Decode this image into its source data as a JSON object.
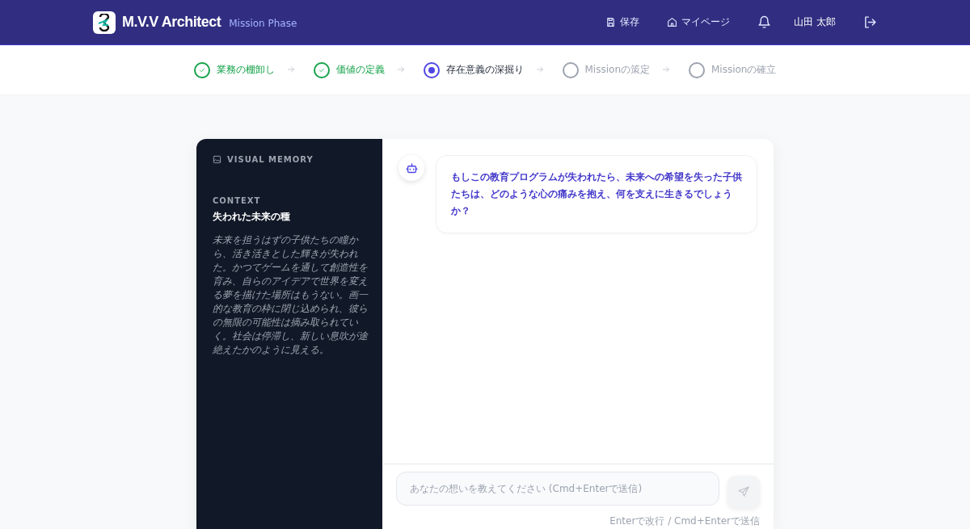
{
  "header": {
    "app_name": "M.V.V Architect",
    "phase": "Mission Phase",
    "actions": [
      {
        "kind": "save",
        "label": "保存"
      },
      {
        "kind": "home",
        "label": "マイページ"
      },
      {
        "kind": "bell"
      },
      {
        "kind": "user",
        "label": "山田 太郎"
      },
      {
        "kind": "logout"
      }
    ]
  },
  "steps": [
    {
      "label": "業務の棚卸し",
      "completed": true,
      "selected": false
    },
    {
      "label": "価値の定義",
      "completed": true,
      "selected": false
    },
    {
      "label": "存在意義の深掘り",
      "completed": false,
      "selected": true
    },
    {
      "label": "Missionの策定",
      "completed": false,
      "selected": false
    },
    {
      "label": "Missionの確立",
      "completed": false,
      "selected": false
    }
  ],
  "memory": {
    "title": "VISUAL MEMORY",
    "context_label": "CONTEXT",
    "context_title": "失われた未来の種",
    "context_text": "未来を担うはずの子供たちの瞳から、活き活きとした輝きが失われた。かつてゲームを通して創造性を育み、自らのアイデアで世界を変える夢を描けた場所はもうない。画一的な教育の枠に閉じ込められ、彼らの無限の可能性は摘み取られていく。社会は停滞し、新しい息吹が途絶えたかのように見える。"
  },
  "chat": {
    "messages": [
      {
        "kind": "bot",
        "text": "もしこの教育プログラムが失われたら、未来への希望を失った子供たちは、どのような心の痛みを抱え、何を支えに生きるでしょうか？"
      }
    ],
    "input": {
      "placeholder": "あなたの想いを教えてください (Cmd+Enterで送信)"
    },
    "hint": "Enterで改行 / Cmd+Enterで送信"
  }
}
